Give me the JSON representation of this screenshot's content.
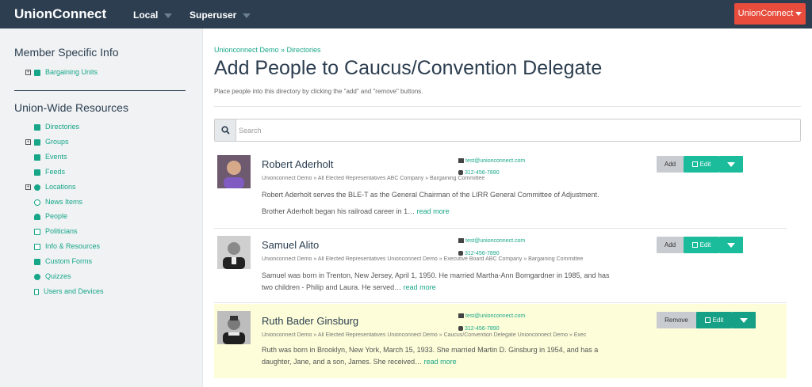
{
  "topbar": {
    "brand": "UnionConnect",
    "nav": [
      {
        "label": "Local"
      },
      {
        "label": "Superuser"
      }
    ],
    "account_button": "UnionConnect"
  },
  "sidebar": {
    "member_heading": "Member Specific Info",
    "member_items": [
      {
        "label": "Bargaining Units",
        "icon": "truck-icon",
        "expandable": true
      }
    ],
    "union_heading": "Union-Wide Resources",
    "union_items": [
      {
        "label": "Directories",
        "icon": "book-icon",
        "expandable": false
      },
      {
        "label": "Groups",
        "icon": "users-icon",
        "expandable": true
      },
      {
        "label": "Events",
        "icon": "calendar-icon",
        "expandable": false
      },
      {
        "label": "Feeds",
        "icon": "rss-icon",
        "expandable": false
      },
      {
        "label": "Locations",
        "icon": "globe-icon",
        "expandable": true
      },
      {
        "label": "News Items",
        "icon": "clock-icon",
        "expandable": false
      },
      {
        "label": "People",
        "icon": "user-icon",
        "expandable": false
      },
      {
        "label": "Politicians",
        "icon": "document-icon",
        "expandable": false
      },
      {
        "label": "Info & Resources",
        "icon": "folder-icon",
        "expandable": false
      },
      {
        "label": "Custom Forms",
        "icon": "list-icon",
        "expandable": false
      },
      {
        "label": "Quizzes",
        "icon": "question-icon",
        "expandable": false
      },
      {
        "label": "Users and Devices",
        "icon": "mobile-icon",
        "expandable": false
      }
    ]
  },
  "main": {
    "breadcrumb": "Unionconnect Demo » Directories",
    "title": "Add People to Caucus/Convention Delegate",
    "subtitle": "Place people into this directory by clicking the \"add\" and \"remove\" buttons.",
    "search_placeholder": "Search"
  },
  "people": [
    {
      "name": "Robert Aderholt",
      "email": "test@unionconnect.com",
      "phone": "312-456-7890",
      "directories": "Unionconnect Demo » All Elected Representatives   ABC Company » Bargaining Committee",
      "bio_line1": "Robert Aderholt serves the BLE-T as the General Chairman of the LIRR General Committee of Adjustment.",
      "bio_line2": "Brother Aderholt began his railroad career in 1…",
      "read_more": "read more",
      "action_label": "Add",
      "edit_label": "Edit",
      "in_directory": false
    },
    {
      "name": "Samuel Alito",
      "email": "test@unionconnect.com",
      "phone": "312-456-7890",
      "directories": "Unionconnect Demo » All Elected Representatives   Unionconnect Demo » Executive Board   ABC Company » Bargaining Committee",
      "bio_line1": "Samuel was born in Trenton, New Jersey, April 1, 1950. He married Martha-Ann Bomgardner in 1985, and has",
      "bio_line2": "two children - Philip and Laura. He served…",
      "read_more": "read more",
      "action_label": "Add",
      "edit_label": "Edit",
      "in_directory": false
    },
    {
      "name": "Ruth Bader Ginsburg",
      "email": "test@unionconnect.com",
      "phone": "312-456-7890",
      "directories": "Unionconnect Demo » All Elected Representatives   Unionconnect Demo » Caucus/Convention Delegate   Unionconnect Demo » Exec",
      "bio_line1": "Ruth was born in Brooklyn, New York, March 15, 1933. She married Martin D. Ginsburg in 1954, and has a",
      "bio_line2": "daughter, Jane, and a son, James. She received…",
      "read_more": "read more",
      "action_label": "Remove",
      "edit_label": "Edit",
      "in_directory": true
    }
  ],
  "colors": {
    "topbar": "#2c3e50",
    "accent": "#18a689",
    "button_green": "#1abc9c",
    "account_red": "#e74c3c",
    "highlight_row": "#fdfdd9"
  }
}
